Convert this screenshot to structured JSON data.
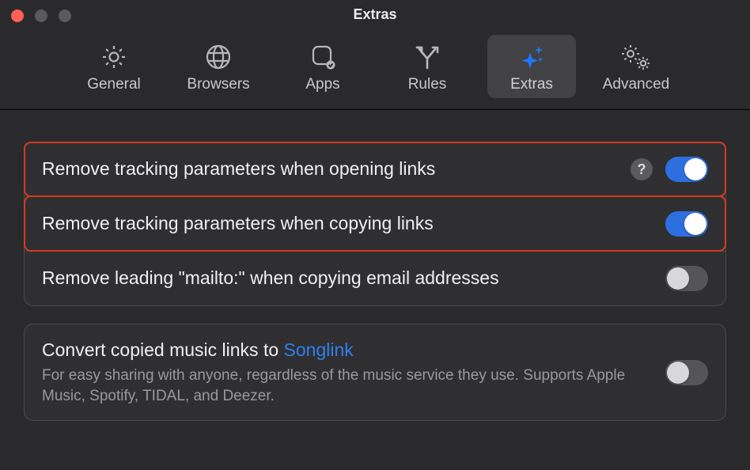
{
  "window": {
    "title": "Extras"
  },
  "toolbar": {
    "items": [
      {
        "label": "General"
      },
      {
        "label": "Browsers"
      },
      {
        "label": "Apps"
      },
      {
        "label": "Rules"
      },
      {
        "label": "Extras"
      },
      {
        "label": "Advanced"
      }
    ],
    "selected_index": 4
  },
  "settings": {
    "remove_tracking_open": {
      "label": "Remove tracking parameters when opening links",
      "help": "?",
      "on": true
    },
    "remove_tracking_copy": {
      "label": "Remove tracking parameters when copying links",
      "on": true
    },
    "remove_mailto": {
      "label": "Remove leading \"mailto:\" when copying email addresses",
      "on": false
    },
    "songlink": {
      "label_prefix": "Convert copied music links to ",
      "label_link": "Songlink",
      "description": "For easy sharing with anyone, regardless of the music service they use. Supports Apple Music, Spotify, TIDAL, and Deezer.",
      "on": false
    }
  },
  "colors": {
    "accent": "#2e6fe0",
    "highlight": "#d13b1f"
  }
}
